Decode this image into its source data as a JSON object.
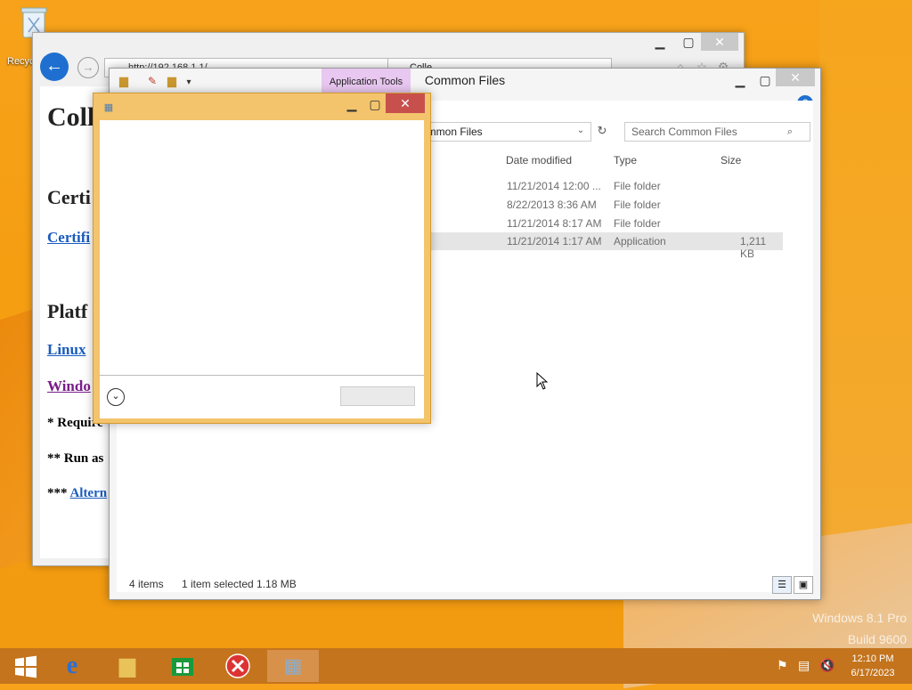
{
  "desktop": {
    "recycle_label": "Recyc",
    "watermark_line1": "Windows 8.1 Pro",
    "watermark_line2": "Build 9600"
  },
  "ie": {
    "address": "http://192.168.1.1/",
    "tab_title": "Colle",
    "heading": "Coll",
    "section1": "Certi",
    "link1": "Certifi",
    "section2": "Platf",
    "link2": "Linux",
    "link3": "Windo",
    "note1": "* Require",
    "note2": "** Run as",
    "note3_prefix": "***",
    "note3_link": "Altern"
  },
  "explorer": {
    "title": "Common Files",
    "contextual_tab": "Application Tools",
    "path": "ommon Files",
    "search_placeholder": "Search Common Files",
    "columns": {
      "date": "Date modified",
      "type": "Type",
      "size": "Size"
    },
    "rows": [
      {
        "date": "11/21/2014 12:00 ...",
        "type": "File folder",
        "size": ""
      },
      {
        "date": "8/22/2013 8:36 AM",
        "type": "File folder",
        "size": ""
      },
      {
        "date": "11/21/2014 8:17 AM",
        "type": "File folder",
        "size": ""
      },
      {
        "date": "11/21/2014 1:17 AM",
        "type": "Application",
        "size": "1,211 KB"
      }
    ],
    "status_items": "4 items",
    "status_selected": "1 item selected  1.18 MB"
  },
  "taskbar": {
    "time": "12:10 PM",
    "date": "6/17/2023",
    "accent": "#c4741d"
  }
}
